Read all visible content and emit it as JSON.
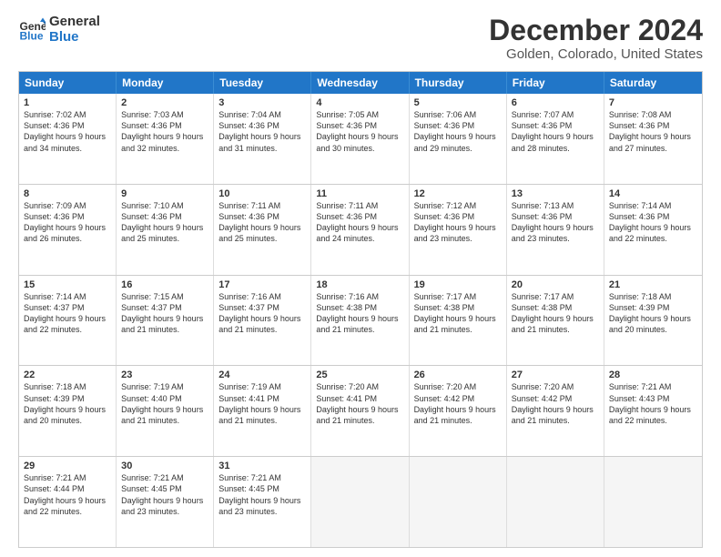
{
  "logo": {
    "line1": "General",
    "line2": "Blue"
  },
  "title": "December 2024",
  "subtitle": "Golden, Colorado, United States",
  "days": [
    "Sunday",
    "Monday",
    "Tuesday",
    "Wednesday",
    "Thursday",
    "Friday",
    "Saturday"
  ],
  "weeks": [
    [
      {
        "day": "1",
        "sunrise": "7:02 AM",
        "sunset": "4:36 PM",
        "daylight": "9 hours and 34 minutes."
      },
      {
        "day": "2",
        "sunrise": "7:03 AM",
        "sunset": "4:36 PM",
        "daylight": "9 hours and 32 minutes."
      },
      {
        "day": "3",
        "sunrise": "7:04 AM",
        "sunset": "4:36 PM",
        "daylight": "9 hours and 31 minutes."
      },
      {
        "day": "4",
        "sunrise": "7:05 AM",
        "sunset": "4:36 PM",
        "daylight": "9 hours and 30 minutes."
      },
      {
        "day": "5",
        "sunrise": "7:06 AM",
        "sunset": "4:36 PM",
        "daylight": "9 hours and 29 minutes."
      },
      {
        "day": "6",
        "sunrise": "7:07 AM",
        "sunset": "4:36 PM",
        "daylight": "9 hours and 28 minutes."
      },
      {
        "day": "7",
        "sunrise": "7:08 AM",
        "sunset": "4:36 PM",
        "daylight": "9 hours and 27 minutes."
      }
    ],
    [
      {
        "day": "8",
        "sunrise": "7:09 AM",
        "sunset": "4:36 PM",
        "daylight": "9 hours and 26 minutes."
      },
      {
        "day": "9",
        "sunrise": "7:10 AM",
        "sunset": "4:36 PM",
        "daylight": "9 hours and 25 minutes."
      },
      {
        "day": "10",
        "sunrise": "7:11 AM",
        "sunset": "4:36 PM",
        "daylight": "9 hours and 25 minutes."
      },
      {
        "day": "11",
        "sunrise": "7:11 AM",
        "sunset": "4:36 PM",
        "daylight": "9 hours and 24 minutes."
      },
      {
        "day": "12",
        "sunrise": "7:12 AM",
        "sunset": "4:36 PM",
        "daylight": "9 hours and 23 minutes."
      },
      {
        "day": "13",
        "sunrise": "7:13 AM",
        "sunset": "4:36 PM",
        "daylight": "9 hours and 23 minutes."
      },
      {
        "day": "14",
        "sunrise": "7:14 AM",
        "sunset": "4:36 PM",
        "daylight": "9 hours and 22 minutes."
      }
    ],
    [
      {
        "day": "15",
        "sunrise": "7:14 AM",
        "sunset": "4:37 PM",
        "daylight": "9 hours and 22 minutes."
      },
      {
        "day": "16",
        "sunrise": "7:15 AM",
        "sunset": "4:37 PM",
        "daylight": "9 hours and 21 minutes."
      },
      {
        "day": "17",
        "sunrise": "7:16 AM",
        "sunset": "4:37 PM",
        "daylight": "9 hours and 21 minutes."
      },
      {
        "day": "18",
        "sunrise": "7:16 AM",
        "sunset": "4:38 PM",
        "daylight": "9 hours and 21 minutes."
      },
      {
        "day": "19",
        "sunrise": "7:17 AM",
        "sunset": "4:38 PM",
        "daylight": "9 hours and 21 minutes."
      },
      {
        "day": "20",
        "sunrise": "7:17 AM",
        "sunset": "4:38 PM",
        "daylight": "9 hours and 21 minutes."
      },
      {
        "day": "21",
        "sunrise": "7:18 AM",
        "sunset": "4:39 PM",
        "daylight": "9 hours and 20 minutes."
      }
    ],
    [
      {
        "day": "22",
        "sunrise": "7:18 AM",
        "sunset": "4:39 PM",
        "daylight": "9 hours and 20 minutes."
      },
      {
        "day": "23",
        "sunrise": "7:19 AM",
        "sunset": "4:40 PM",
        "daylight": "9 hours and 21 minutes."
      },
      {
        "day": "24",
        "sunrise": "7:19 AM",
        "sunset": "4:41 PM",
        "daylight": "9 hours and 21 minutes."
      },
      {
        "day": "25",
        "sunrise": "7:20 AM",
        "sunset": "4:41 PM",
        "daylight": "9 hours and 21 minutes."
      },
      {
        "day": "26",
        "sunrise": "7:20 AM",
        "sunset": "4:42 PM",
        "daylight": "9 hours and 21 minutes."
      },
      {
        "day": "27",
        "sunrise": "7:20 AM",
        "sunset": "4:42 PM",
        "daylight": "9 hours and 21 minutes."
      },
      {
        "day": "28",
        "sunrise": "7:21 AM",
        "sunset": "4:43 PM",
        "daylight": "9 hours and 22 minutes."
      }
    ],
    [
      {
        "day": "29",
        "sunrise": "7:21 AM",
        "sunset": "4:44 PM",
        "daylight": "9 hours and 22 minutes."
      },
      {
        "day": "30",
        "sunrise": "7:21 AM",
        "sunset": "4:45 PM",
        "daylight": "9 hours and 23 minutes."
      },
      {
        "day": "31",
        "sunrise": "7:21 AM",
        "sunset": "4:45 PM",
        "daylight": "9 hours and 23 minutes."
      },
      null,
      null,
      null,
      null
    ]
  ]
}
